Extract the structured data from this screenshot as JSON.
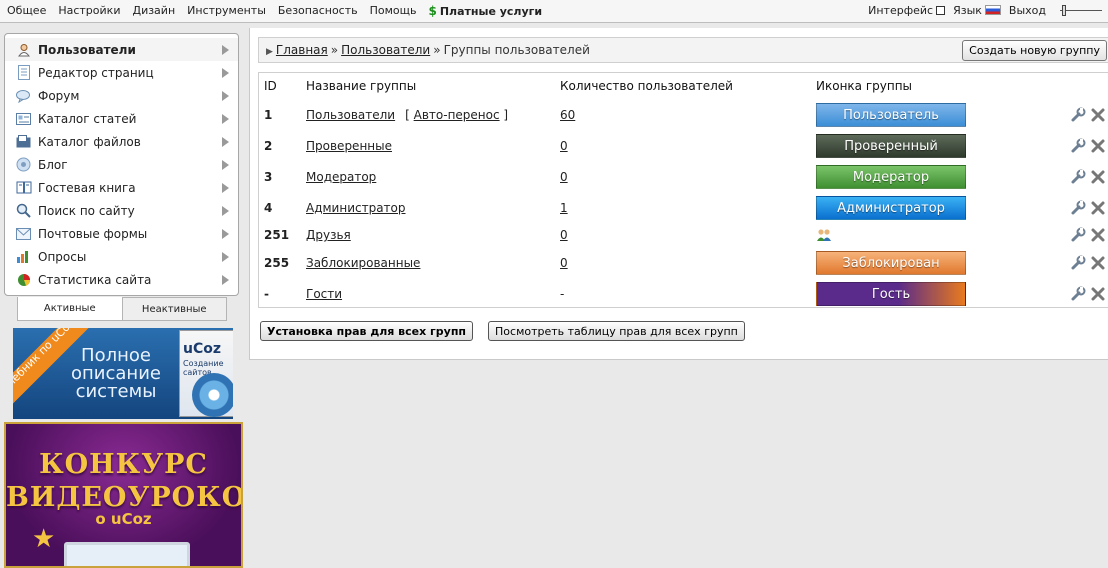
{
  "topbar": {
    "menu": [
      "Общее",
      "Настройки",
      "Дизайн",
      "Инструменты",
      "Безопасность",
      "Помощь"
    ],
    "paid": "Платные услуги",
    "interface_label": "Интерфейс",
    "language_label": "Язык",
    "logout_label": "Выход"
  },
  "sidebar": {
    "items": [
      {
        "label": "Пользователи",
        "icon": "user-icon"
      },
      {
        "label": "Редактор страниц",
        "icon": "page-icon"
      },
      {
        "label": "Форум",
        "icon": "forum-icon"
      },
      {
        "label": "Каталог статей",
        "icon": "articles-icon"
      },
      {
        "label": "Каталог файлов",
        "icon": "files-icon"
      },
      {
        "label": "Блог",
        "icon": "blog-icon"
      },
      {
        "label": "Гостевая книга",
        "icon": "guestbook-icon"
      },
      {
        "label": "Поиск по сайту",
        "icon": "search-icon"
      },
      {
        "label": "Почтовые формы",
        "icon": "mail-icon"
      },
      {
        "label": "Опросы",
        "icon": "poll-icon"
      },
      {
        "label": "Статистика сайта",
        "icon": "stats-icon"
      }
    ],
    "tabs": [
      "Активные",
      "Неактивные"
    ]
  },
  "banner1": {
    "ribbon": "Учебник по uCoz",
    "text": "Полное описание системы",
    "book_brand": "uCoz",
    "book_sub": "Создание сайтов"
  },
  "banner2": {
    "title": "КОНКУРС ВИДЕОУРОКОВ",
    "sub": "о uCoz"
  },
  "breadcrumb": {
    "home": "Главная",
    "sep": "»",
    "users": "Пользователи",
    "current": "Группы пользователей"
  },
  "create_button": "Создать новую группу",
  "table": {
    "headers": [
      "ID",
      "Название группы",
      "Количество пользователей",
      "Иконка группы"
    ],
    "extra_open": "[",
    "extra_link": "Авто-перенос",
    "extra_close": "]",
    "rows": [
      {
        "id": "1",
        "name": "Пользователи",
        "count": "60",
        "badge": "Пользователь",
        "badge_colors": [
          "#7fb6ea",
          "#3b8ed6"
        ]
      },
      {
        "id": "2",
        "name": "Проверенные",
        "count": "0",
        "badge": "Проверенный",
        "badge_colors": [
          "#5d6a5a",
          "#2f3a2c"
        ]
      },
      {
        "id": "3",
        "name": "Модератор",
        "count": "0",
        "badge": "Модератор",
        "badge_colors": [
          "#7bc46a",
          "#3f8f31"
        ]
      },
      {
        "id": "4",
        "name": "Администратор",
        "count": "1",
        "badge": "Администратор",
        "badge_colors": [
          "#3ab2f4",
          "#0a6fcf"
        ]
      },
      {
        "id": "251",
        "name": "Друзья",
        "count": "0",
        "badge": "",
        "badge_colors": []
      },
      {
        "id": "255",
        "name": "Заблокированные",
        "count": "0",
        "badge": "Заблокирован",
        "badge_colors": [
          "#f7b37a",
          "#e0782e"
        ]
      },
      {
        "id": "-",
        "name": "Гости",
        "count": "-",
        "badge": "Гость",
        "badge_colors": [
          "#5a2b8a",
          "#e87a1e"
        ]
      }
    ]
  },
  "buttons": {
    "set_rights": "Установка прав для всех групп",
    "view_table": "Посмотреть таблицу прав для всех групп"
  }
}
